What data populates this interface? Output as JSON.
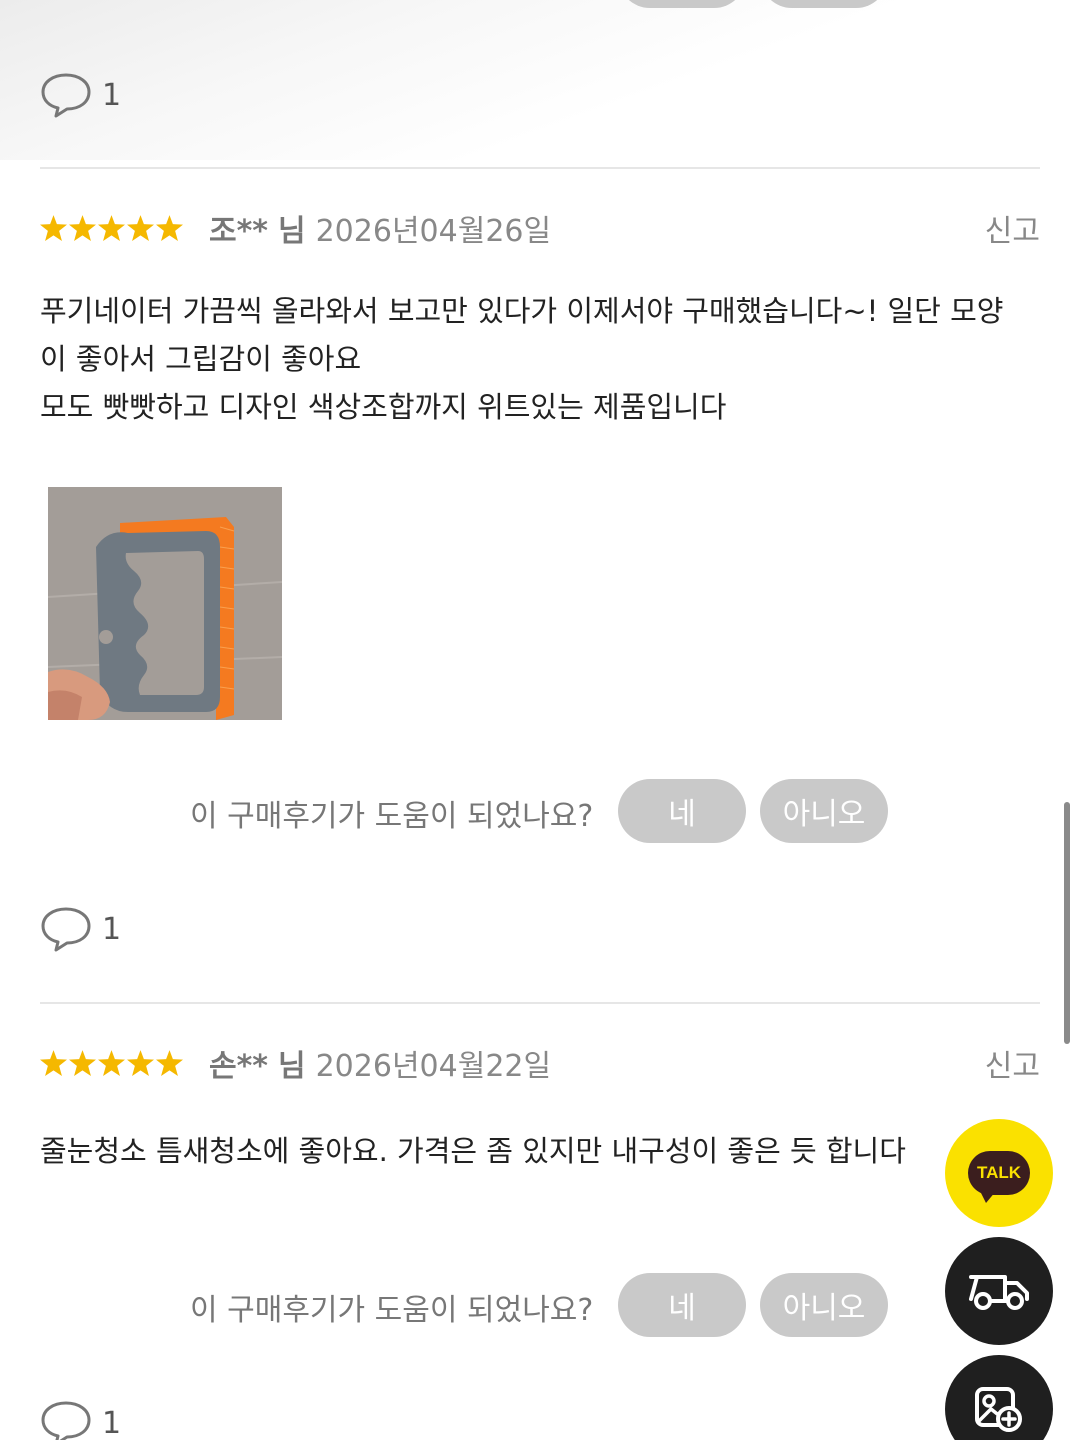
{
  "helpful": {
    "question": "이 구매후기가 도움이 되었나요?",
    "yes_label": "네",
    "no_label": "아니오"
  },
  "reviews": [
    {
      "comment_count": "1"
    },
    {
      "rating": 5,
      "author": "조**",
      "author_suffix": "님",
      "date": "2026년04월26일",
      "report_label": "신고",
      "text_lines": [
        "푸기네이터 가끔씩 올라와서 보고만 있다가 이제서야 구매했습니다~! 일단 모양",
        "이 좋아서 그립감이 좋아요",
        "모도 빳빳하고 디자인 색상조합까지 위트있는 제품입니다"
      ],
      "comment_count": "1"
    },
    {
      "rating": 5,
      "author": "손**",
      "author_suffix": "님",
      "date": "2026년04월22일",
      "report_label": "신고",
      "text_lines": [
        "줄눈청소 틈새청소에 좋아요. 가격은 좀 있지만 내구성이 좋은 듯 합니다"
      ],
      "comment_count": "1"
    }
  ],
  "floating": {
    "kakao_label": "TALK",
    "kakao_color": "#fae100",
    "delivery_icon": "delivery-truck-icon",
    "photo_review_icon": "photo-search-icon"
  },
  "colors": {
    "star": "#f5b800",
    "pill": "#c9c9c9",
    "divider": "#e6e6e6"
  }
}
